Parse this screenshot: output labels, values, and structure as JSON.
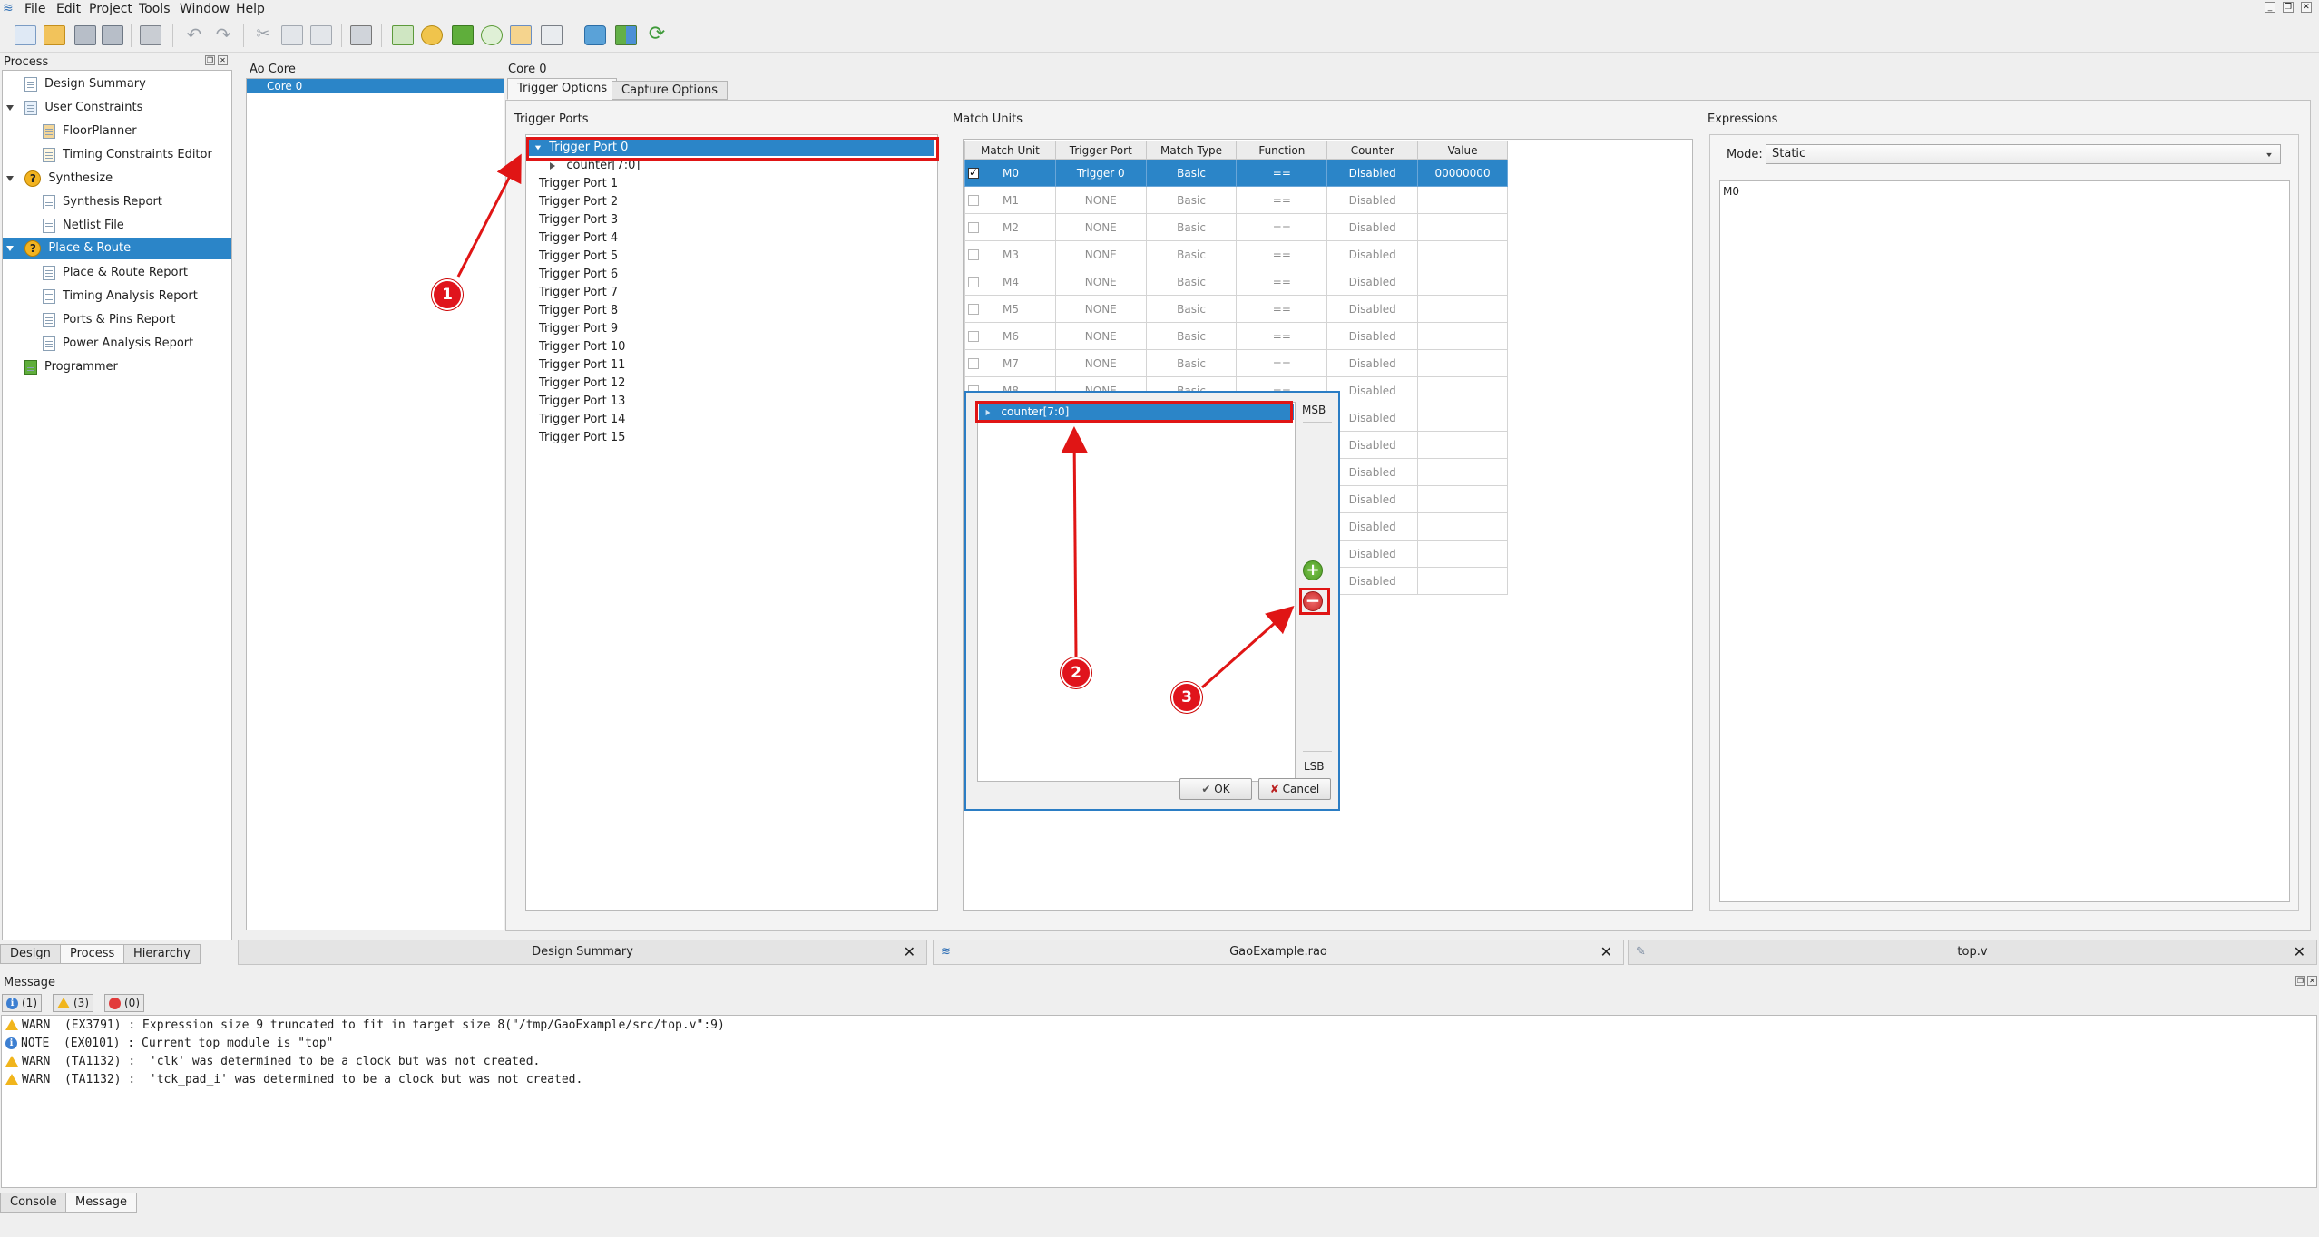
{
  "menu": [
    "File",
    "Edit",
    "Project",
    "Tools",
    "Window",
    "Help"
  ],
  "toolbar_icons": [
    "new-file-icon",
    "open-folder-icon",
    "save-icon",
    "save-all-icon",
    "print-icon",
    "undo-icon",
    "redo-icon",
    "cut-icon",
    "copy-icon",
    "paste-icon",
    "find-icon",
    "run-synthesize-icon",
    "run-place-route-icon",
    "program-device-icon",
    "timing-constraints-icon",
    "floorplanner-icon",
    "analyzer-icon",
    "gao-icon",
    "layout-icon",
    "refresh-icon"
  ],
  "process_panel": {
    "title": "Process",
    "items": [
      {
        "label": "Design Summary",
        "icon": "doc-icon",
        "level": 1
      },
      {
        "label": "User Constraints",
        "icon": "constraints-icon",
        "level": 0,
        "expanded": true
      },
      {
        "label": "FloorPlanner",
        "icon": "floorplanner-icon",
        "level": 1
      },
      {
        "label": "Timing Constraints Editor",
        "icon": "timing-icon",
        "level": 1
      },
      {
        "label": "Synthesize",
        "icon": "question-icon",
        "level": 0,
        "expanded": true
      },
      {
        "label": "Synthesis Report",
        "icon": "doc-icon",
        "level": 1
      },
      {
        "label": "Netlist File",
        "icon": "doc-icon",
        "level": 1
      },
      {
        "label": "Place & Route",
        "icon": "question-icon",
        "level": 0,
        "expanded": true,
        "selected": true
      },
      {
        "label": "Place & Route Report",
        "icon": "doc-icon",
        "level": 1
      },
      {
        "label": "Timing Analysis Report",
        "icon": "doc-icon",
        "level": 1
      },
      {
        "label": "Ports & Pins Report",
        "icon": "doc-icon",
        "level": 1
      },
      {
        "label": "Power Analysis Report",
        "icon": "doc-icon",
        "level": 1
      },
      {
        "label": "Programmer",
        "icon": "programmer-icon",
        "level": 0
      }
    ],
    "bottom_tabs": [
      "Design",
      "Process",
      "Hierarchy"
    ],
    "active_tab": "Process"
  },
  "ao_core": {
    "title": "Ao Core",
    "items": [
      "Core 0"
    ]
  },
  "core": {
    "title": "Core 0",
    "tabs": [
      "Trigger Options",
      "Capture Options"
    ],
    "active_tab": "Trigger Options"
  },
  "trigger_ports": {
    "title": "Trigger Ports",
    "selected": "Trigger Port 0",
    "child": "counter[7:0]",
    "others": [
      "Trigger Port 1",
      "Trigger Port 2",
      "Trigger Port 3",
      "Trigger Port 4",
      "Trigger Port 5",
      "Trigger Port 6",
      "Trigger Port 7",
      "Trigger Port 8",
      "Trigger Port 9",
      "Trigger Port 10",
      "Trigger Port 11",
      "Trigger Port 12",
      "Trigger Port 13",
      "Trigger Port 14",
      "Trigger Port 15"
    ]
  },
  "match_units": {
    "title": "Match Units",
    "headers": [
      "Match Unit",
      "Trigger Port",
      "Match Type",
      "Function",
      "Counter",
      "Value"
    ],
    "rows": [
      {
        "unit": "M0",
        "port": "Trigger 0",
        "type": "Basic",
        "func": "==",
        "counter": "Disabled",
        "value": "00000000",
        "checked": true
      },
      {
        "unit": "M1",
        "port": "NONE",
        "type": "Basic",
        "func": "==",
        "counter": "Disabled",
        "value": "",
        "checked": false
      },
      {
        "unit": "M2",
        "port": "NONE",
        "type": "Basic",
        "func": "==",
        "counter": "Disabled",
        "value": "",
        "checked": false
      },
      {
        "unit": "M3",
        "port": "NONE",
        "type": "Basic",
        "func": "==",
        "counter": "Disabled",
        "value": "",
        "checked": false
      },
      {
        "unit": "M4",
        "port": "NONE",
        "type": "Basic",
        "func": "==",
        "counter": "Disabled",
        "value": "",
        "checked": false
      },
      {
        "unit": "M5",
        "port": "NONE",
        "type": "Basic",
        "func": "==",
        "counter": "Disabled",
        "value": "",
        "checked": false
      },
      {
        "unit": "M6",
        "port": "NONE",
        "type": "Basic",
        "func": "==",
        "counter": "Disabled",
        "value": "",
        "checked": false
      },
      {
        "unit": "M7",
        "port": "NONE",
        "type": "Basic",
        "func": "==",
        "counter": "Disabled",
        "value": "",
        "checked": false
      },
      {
        "unit": "M8",
        "port": "NONE",
        "type": "Basic",
        "func": "==",
        "counter": "Disabled",
        "value": "",
        "checked": false
      },
      {
        "unit": "",
        "port": "",
        "type": "",
        "func": "",
        "counter": "Disabled",
        "value": "",
        "checked": false
      },
      {
        "unit": "",
        "port": "",
        "type": "",
        "func": "",
        "counter": "Disabled",
        "value": "",
        "checked": false
      },
      {
        "unit": "",
        "port": "",
        "type": "",
        "func": "",
        "counter": "Disabled",
        "value": "",
        "checked": false
      },
      {
        "unit": "",
        "port": "",
        "type": "",
        "func": "",
        "counter": "Disabled",
        "value": "",
        "checked": false
      },
      {
        "unit": "",
        "port": "",
        "type": "",
        "func": "",
        "counter": "Disabled",
        "value": "",
        "checked": false
      },
      {
        "unit": "",
        "port": "",
        "type": "",
        "func": "",
        "counter": "Disabled",
        "value": "",
        "checked": false
      },
      {
        "unit": "",
        "port": "",
        "type": "",
        "func": "",
        "counter": "Disabled",
        "value": "",
        "checked": false
      }
    ]
  },
  "expressions": {
    "title": "Expressions",
    "mode_label": "Mode:",
    "mode_value": "Static",
    "text": "M0"
  },
  "signal_dialog": {
    "item": "counter[7:0]",
    "msb": "MSB",
    "lsb": "LSB",
    "ok": "OK",
    "cancel": "Cancel"
  },
  "annotations": [
    "1",
    "2",
    "3"
  ],
  "doc_tabs": [
    {
      "label": "Design Summary"
    },
    {
      "label": "GaoExample.rao"
    },
    {
      "label": "top.v"
    }
  ],
  "message": {
    "title": "Message",
    "filters": [
      "(1)",
      "(3)",
      "(0)"
    ],
    "lines": [
      {
        "level": "warn",
        "text": "WARN  (EX3791) : Expression size 9 truncated to fit in target size 8(\"/tmp/GaoExample/src/top.v\":9)"
      },
      {
        "level": "info",
        "text": "NOTE  (EX0101) : Current top module is \"top\""
      },
      {
        "level": "warn",
        "text": "WARN  (TA1132) :  'clk' was determined to be a clock but was not created."
      },
      {
        "level": "warn",
        "text": "WARN  (TA1132) :  'tck_pad_i' was determined to be a clock but was not created."
      }
    ]
  },
  "bottom_tabs": [
    "Console",
    "Message"
  ],
  "bottom_active": "Message",
  "colors": {
    "selection": "#2b85c8",
    "annotation": "#e01515"
  }
}
